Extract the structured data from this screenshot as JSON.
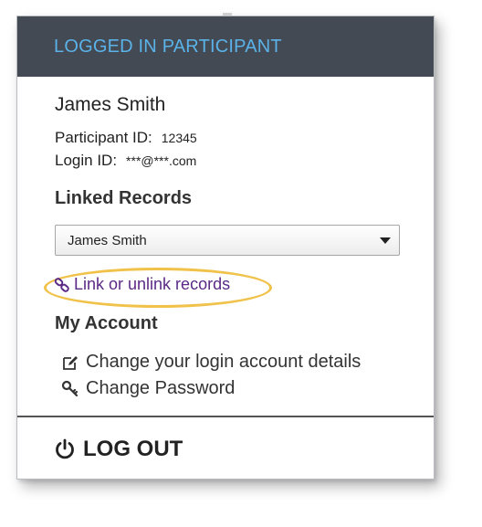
{
  "header": {
    "title": "LOGGED IN PARTICIPANT"
  },
  "participant": {
    "name": "James Smith",
    "participant_id_label": "Participant ID:",
    "participant_id_value": "12345",
    "login_id_label": "Login ID:",
    "login_id_value": "***@***.com"
  },
  "linked_records": {
    "title": "Linked Records",
    "selected": "James Smith",
    "link_label": "Link or unlink records",
    "link_icon": "chain-link-icon"
  },
  "my_account": {
    "title": "My Account",
    "items": [
      {
        "label": "Change your login account details",
        "icon": "edit-icon"
      },
      {
        "label": "Change Password",
        "icon": "key-icon"
      }
    ]
  },
  "logout": {
    "label": "LOG OUT",
    "icon": "power-icon"
  },
  "colors": {
    "header_bg": "#444a53",
    "header_text": "#5ab2e8",
    "link": "#5b2a86",
    "highlight": "#f0c24a"
  }
}
